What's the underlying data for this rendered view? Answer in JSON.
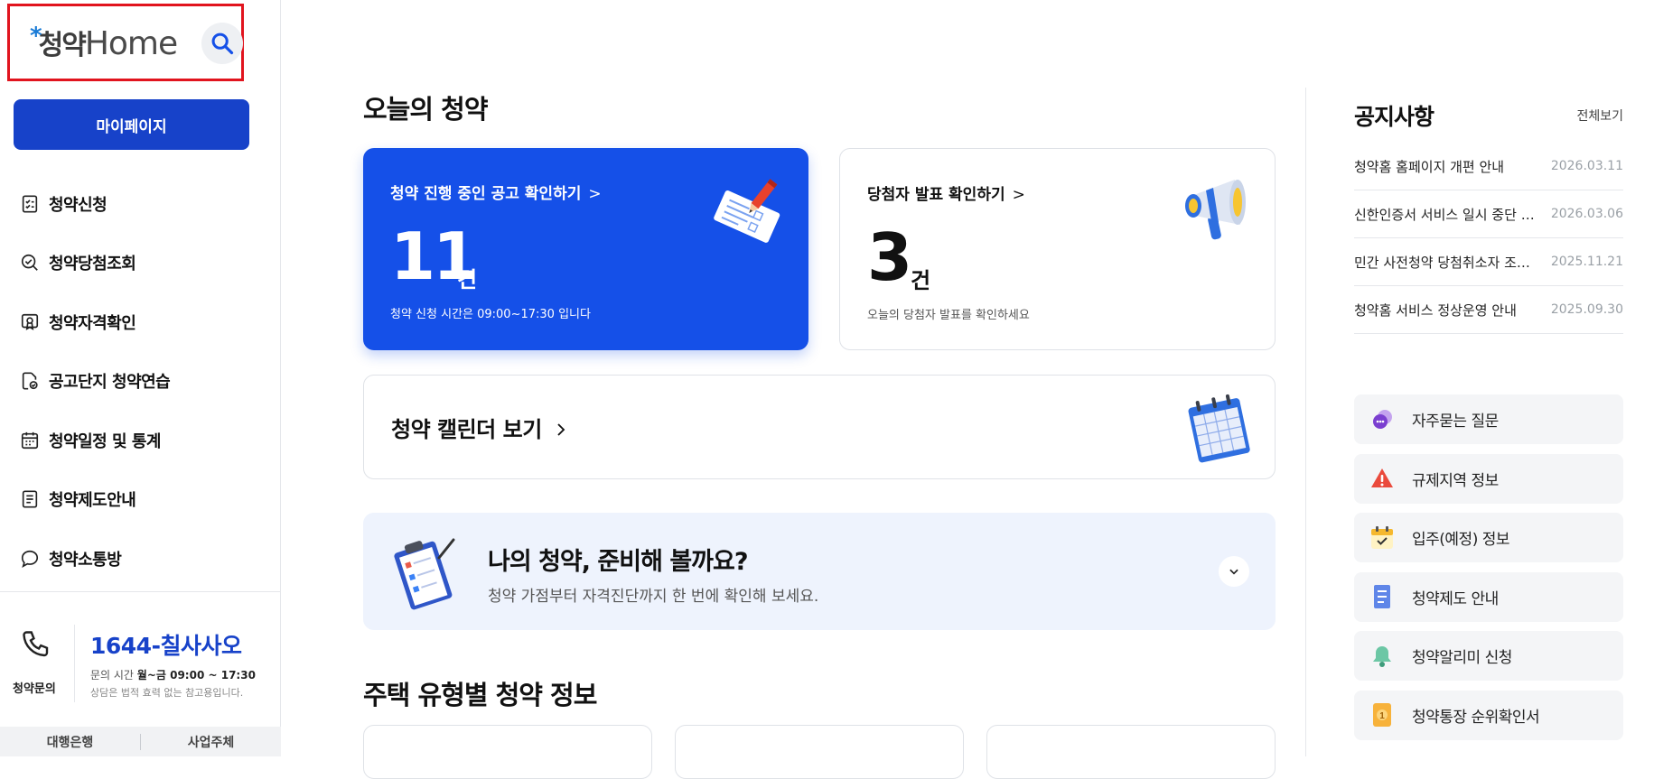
{
  "sidebar": {
    "logo": {
      "star": "*",
      "ko": "청약",
      "en": "Home"
    },
    "mypage_label": "마이페이지",
    "menu": [
      {
        "label": "청약신청",
        "icon": "checklist-icon"
      },
      {
        "label": "청약당첨조회",
        "icon": "search-check-icon"
      },
      {
        "label": "청약자격확인",
        "icon": "certificate-icon"
      },
      {
        "label": "공고단지 청약연습",
        "icon": "practice-doc-icon"
      },
      {
        "label": "청약일정 및 통계",
        "icon": "calendar-icon"
      },
      {
        "label": "청약제도안내",
        "icon": "document-icon"
      },
      {
        "label": "청약소통방",
        "icon": "chat-bubble-icon"
      }
    ],
    "contact": {
      "label": "청약문의",
      "phone": "1644-칠사사오",
      "hours_prefix": "문의 시간 ",
      "hours_value": "월~금 09:00 ~ 17:30",
      "note": "상담은 법적 효력 없는 참고용입니다."
    },
    "bottom_tabs": [
      "대행은행",
      "사업주체"
    ]
  },
  "main": {
    "today_title": "오늘의 청약",
    "ongoing": {
      "title": "청약 진행 중인 공고 확인하기",
      "chevron": ">",
      "count": "11",
      "unit": "건",
      "sub": "청약 신청 시간은 09:00~17:30 입니다"
    },
    "winners": {
      "title": "당첨자 발표 확인하기",
      "chevron": ">",
      "count": "3",
      "unit": "건",
      "sub": "오늘의 당첨자 발표를 확인하세요"
    },
    "calendar_label": "청약 캘린더 보기",
    "prep": {
      "title": "나의 청약, 준비해 볼까요?",
      "sub": "청약 가점부터 자격진단까지 한 번에 확인해 보세요."
    },
    "types_title": "주택 유형별 청약 정보"
  },
  "notices": {
    "title": "공지사항",
    "all": "전체보기",
    "items": [
      {
        "title": "청약홈 홈페이지 개편 안내",
        "date": "2026.03.11"
      },
      {
        "title": "신한인증서 서비스 일시 중단 안내",
        "date": "2026.03.06"
      },
      {
        "title": "민간 사전청약 당첨취소자 조치 안내",
        "date": "2025.11.21"
      },
      {
        "title": "청약홈 서비스 정상운영 안내",
        "date": "2025.09.30"
      }
    ]
  },
  "quick_links": [
    {
      "label": "자주묻는 질문",
      "icon": "faq-bubble-icon"
    },
    {
      "label": "규제지역 정보",
      "icon": "warning-triangle-icon"
    },
    {
      "label": "입주(예정) 정보",
      "icon": "calendar-check-icon"
    },
    {
      "label": "청약제도 안내",
      "icon": "document-list-icon"
    },
    {
      "label": "청약알리미 신청",
      "icon": "bell-icon"
    },
    {
      "label": "청약통장 순위확인서",
      "icon": "rank-certificate-icon"
    }
  ],
  "colors": {
    "primary": "#1550e8",
    "mypage": "#1742c9",
    "logo_highlight": "#e1141e"
  }
}
